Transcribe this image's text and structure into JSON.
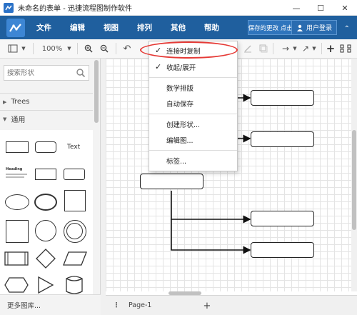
{
  "window": {
    "title": "未命名的表单 - 迅捷流程图制作软件",
    "minimize": "—",
    "maximize": "☐",
    "close": "✕"
  },
  "menubar": {
    "items": [
      "文件",
      "编辑",
      "视图",
      "排列",
      "其他",
      "帮助"
    ],
    "unsaved_notice": "有未保存的更改 点击我保存",
    "login": "用户登录"
  },
  "toolbar": {
    "zoom": "100%"
  },
  "sidebar": {
    "search_placeholder": "搜索形状",
    "sections": [
      {
        "label": "Trees",
        "expanded": false
      },
      {
        "label": "通用",
        "expanded": true
      }
    ],
    "text_shape_label": "Text",
    "heading_shape_label": "Heading",
    "more_libraries": "更多图库..."
  },
  "dropdown": {
    "items": [
      {
        "label": "连接时复制",
        "checked": true
      },
      {
        "label": "收起/展开",
        "checked": true
      },
      {
        "label": "数学排版",
        "checked": false
      },
      {
        "label": "自动保存",
        "checked": false
      },
      {
        "label": "创建形状...",
        "checked": false
      },
      {
        "label": "编辑图...",
        "checked": false
      },
      {
        "label": "标签...",
        "checked": false
      }
    ]
  },
  "bottombar": {
    "page_label": "Page-1",
    "add_page": "+"
  },
  "colors": {
    "menubar": "#1f5f9e",
    "highlight": "#e53935"
  }
}
